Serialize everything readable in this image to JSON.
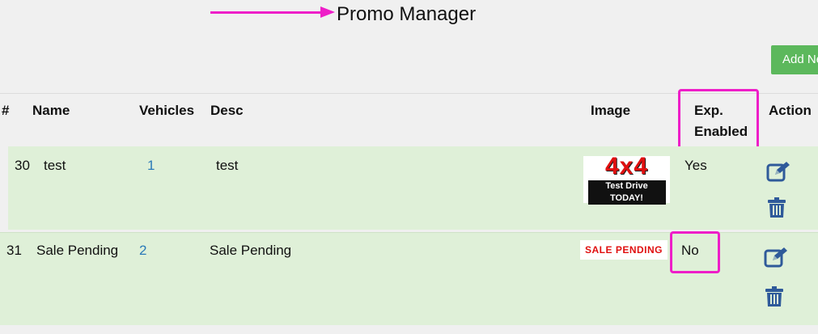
{
  "page": {
    "title": "Promo Manager"
  },
  "toolbar": {
    "add_label": "Add New"
  },
  "table": {
    "headers": {
      "num": "#",
      "name": "Name",
      "vehicles": "Vehicles",
      "desc": "Desc",
      "image": "Image",
      "exp_enabled_line1": "Exp.",
      "exp_enabled_line2": "Enabled",
      "action": "Action"
    },
    "rows": [
      {
        "num": "30",
        "name": "test",
        "vehicles": "1",
        "desc": "test",
        "image_text_main": "4x4",
        "image_text_sub": "Test Drive TODAY!",
        "exp_enabled": "Yes"
      },
      {
        "num": "31",
        "name": "Sale Pending",
        "vehicles": "2",
        "desc": "Sale Pending",
        "image_text_main": "SALE PENDING",
        "exp_enabled": "No"
      }
    ]
  },
  "colors": {
    "accent_highlight": "#ee1ec8",
    "add_button": "#5cb85c",
    "row_background": "#dff0d8",
    "link": "#2a7ab8",
    "action_icon": "#2f5a9a"
  },
  "icons": [
    "arrow-right-icon",
    "edit-icon",
    "trash-icon"
  ]
}
